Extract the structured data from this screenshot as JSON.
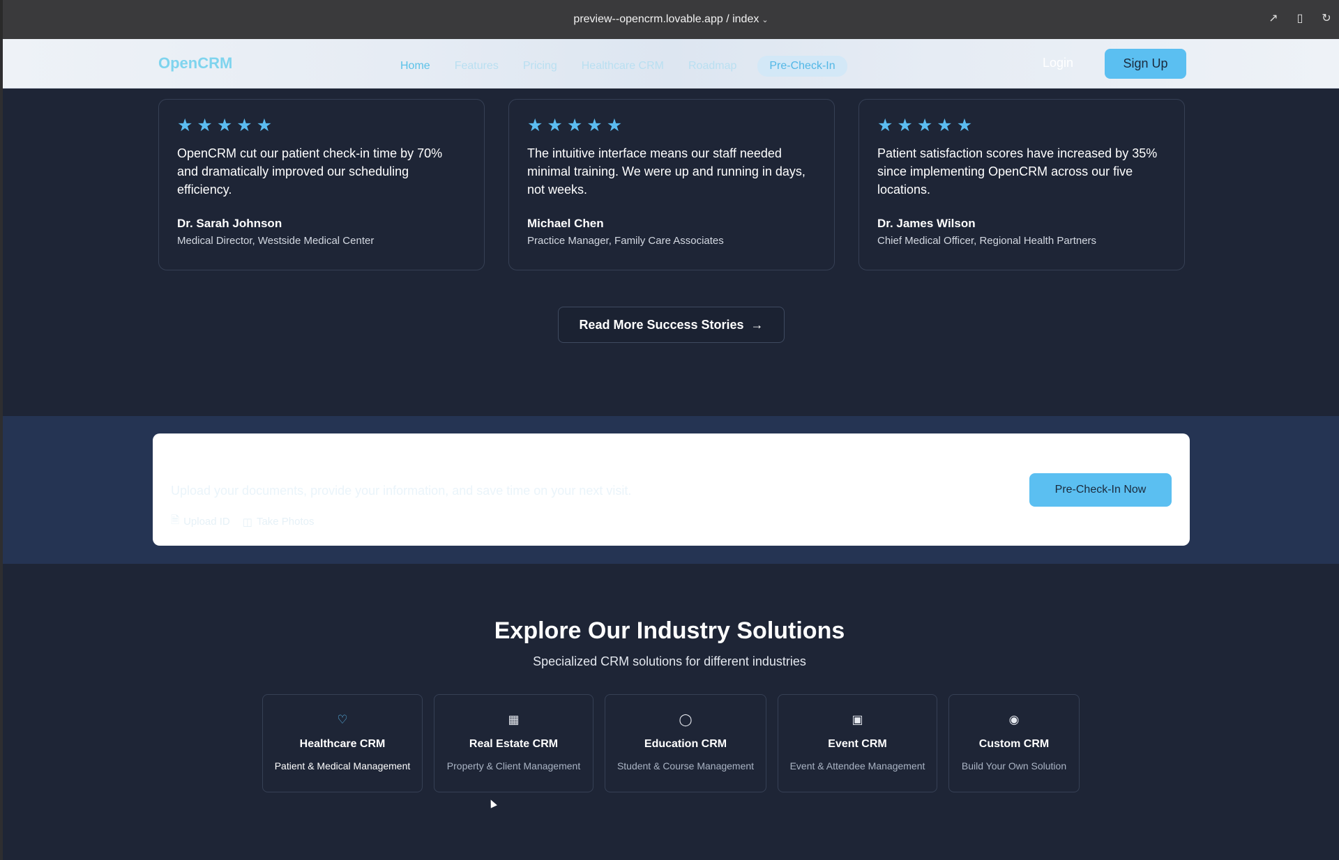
{
  "browser": {
    "url": "preview--opencrm.lovable.app / index",
    "icons": [
      "external-link-icon",
      "mobile-icon",
      "reload-icon"
    ]
  },
  "header": {
    "logo": "OpenCRM",
    "nav": [
      {
        "label": "Home"
      },
      {
        "label": "Features"
      },
      {
        "label": "Pricing"
      },
      {
        "label": "Healthcare CRM"
      },
      {
        "label": "Roadmap"
      },
      {
        "label": "Pre-Check-In"
      }
    ],
    "login": "Login",
    "signup": "Sign Up"
  },
  "testimonials": [
    {
      "rating": 5,
      "quote": "OpenCRM cut our patient check-in time by 70% and dramatically improved our scheduling efficiency.",
      "author": "Dr. Sarah Johnson",
      "role": "Medical Director, Westside Medical Center"
    },
    {
      "rating": 5,
      "quote": "The intuitive interface means our staff needed minimal training. We were up and running in days, not weeks.",
      "author": "Michael Chen",
      "role": "Practice Manager, Family Care Associates"
    },
    {
      "rating": 5,
      "quote": "Patient satisfaction scores have increased by 35% since implementing OpenCRM across our five locations.",
      "author": "Dr. James Wilson",
      "role": "Chief Medical Officer, Regional Health Partners"
    }
  ],
  "read_more": "Read More Success Stories",
  "precheckin": {
    "description": "Upload your documents, provide your information, and save time on your next visit.",
    "upload_id": "Upload ID",
    "take_photos": "Take Photos",
    "button": "Pre-Check-In Now"
  },
  "industries": {
    "title": "Explore Our Industry Solutions",
    "subtitle": "Specialized CRM solutions for different industries",
    "items": [
      {
        "name": "Healthcare CRM",
        "desc": "Patient & Medical Management",
        "icon": "heart-icon"
      },
      {
        "name": "Real Estate CRM",
        "desc": "Property & Client Management",
        "icon": "building-icon"
      },
      {
        "name": "Education CRM",
        "desc": "Student & Course Management",
        "icon": "user-icon"
      },
      {
        "name": "Event CRM",
        "desc": "Event & Attendee Management",
        "icon": "calendar-icon"
      },
      {
        "name": "Custom CRM",
        "desc": "Build Your Own Solution",
        "icon": "lightbulb-icon"
      }
    ]
  },
  "colors": {
    "page_bg": "#1e2536",
    "accent": "#5bbff1",
    "band_bg": "#253453"
  }
}
